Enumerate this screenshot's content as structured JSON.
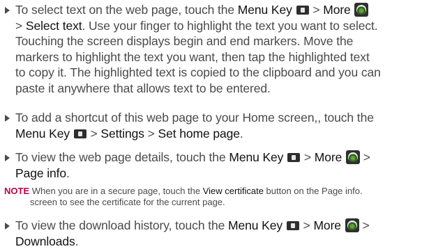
{
  "items": [
    {
      "lines": [
        [
          "To select text on the web page, touch the ",
          {
            "k": "Menu Key"
          },
          " ",
          {
            "icon": "menu-key-icon"
          },
          " > ",
          {
            "k": "More"
          },
          " ",
          {
            "icon": "more-icon"
          }
        ],
        [
          "> ",
          {
            "k": "Select text"
          },
          ". Use your finger to highlight the text you want to select."
        ],
        [
          "Touching the screen displays begin and end markers. Move the"
        ],
        [
          "markers to highlight the text you want, then tap the highlighted text"
        ],
        [
          "to copy it. The highlighted text is copied to the clipboard and you can"
        ],
        [
          "paste it anywhere that allows text to be entered."
        ]
      ]
    },
    {
      "lines": [
        [
          "To add a shortcut of this web page to your Home screen,, touch the"
        ],
        [
          {
            "k": "Menu Key"
          },
          " ",
          {
            "icon": "menu-key-icon"
          },
          " > ",
          {
            "k": "Settings"
          },
          " > ",
          {
            "k": "Set home page"
          },
          "."
        ]
      ]
    },
    {
      "lines": [
        [
          "To view the web page details, touch the ",
          {
            "k": "Menu Key"
          },
          " ",
          {
            "icon": "menu-key-icon"
          },
          " > ",
          {
            "k": "More"
          },
          " ",
          {
            "icon": "more-icon"
          },
          " >"
        ],
        [
          {
            "k": "Page info"
          },
          "."
        ]
      ]
    },
    {
      "lines": [
        [
          "To view the download history, touch the ",
          {
            "k": "Menu Key"
          },
          " ",
          {
            "icon": "menu-key-icon"
          },
          " > ",
          {
            "k": "More"
          },
          " ",
          {
            "icon": "more-icon"
          },
          " >"
        ],
        [
          {
            "k": "Downloads"
          },
          "."
        ]
      ]
    }
  ],
  "note": {
    "label": "NOTE",
    "line1_before": " When you are in a secure page, touch the ",
    "line1_key": "View certificate",
    "line1_after": " button on the Page info.",
    "line2": "screen to see the certificate for the current page."
  }
}
